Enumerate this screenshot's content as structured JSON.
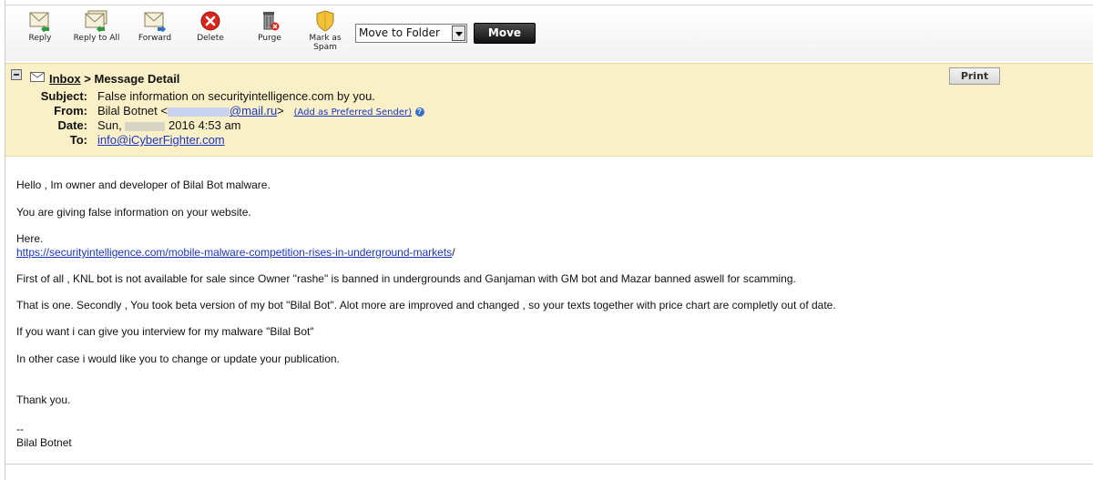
{
  "toolbar": {
    "buttons": [
      {
        "label": "Reply",
        "icon": "reply-icon"
      },
      {
        "label": "Reply to All",
        "icon": "reply-all-icon"
      },
      {
        "label": "Forward",
        "icon": "forward-icon"
      },
      {
        "label": "Delete",
        "icon": "delete-icon"
      },
      {
        "label": "Purge",
        "icon": "purge-icon"
      },
      {
        "label": "Mark as Spam",
        "label_line1": "Mark as",
        "label_line2": "Spam",
        "icon": "spam-shield-icon"
      }
    ],
    "move_select_value": "Move to Folder",
    "move_label": "Move"
  },
  "header": {
    "breadcrumb_link": "Inbox",
    "breadcrumb_rest": " > Message Detail",
    "print_label": "Print",
    "subject_label": "Subject:",
    "subject_value": "False information on securityintelligence.com by you.",
    "from_label": "From:",
    "from_name": "Bilal Botnet <",
    "from_domain": "@mail.ru",
    "from_close": ">",
    "add_preferred": "(Add as Preferred Sender)",
    "date_label": "Date:",
    "date_prefix": "Sun,",
    "date_suffix": "2016 4:53 am",
    "to_label": "To:",
    "to_value": "info@iCyberFighter.com"
  },
  "message": {
    "greeting": "Hello , Im owner and developer of Bilal Bot malware.",
    "line2": "You are giving false information on your website.",
    "here": "Here.",
    "url": "https://securityintelligence.com/mobile-malware-competition-rises-in-underground-markets",
    "url_suffix": "/",
    "para_first": "First of all , KNL bot is not available for sale since Owner \"rashe\" is banned in undergrounds and Ganjaman with GM bot and Mazar banned aswell for scamming.",
    "para_second": "That is one. Secondly , You took beta version of my bot \"Bilal Bot\". Alot more are improved and changed , so your texts together with price chart are completly out of date.",
    "para_interview": "If you want i can give you interview for my malware \"Bilal Bot\"",
    "para_update": "In other case i would like you to change or update your publication.",
    "thanks": "Thank you.",
    "sig_dash": "--",
    "sig_name": "Bilal Botnet"
  },
  "colors": {
    "header_bg": "#f9f0c7",
    "link": "#1a35c9",
    "move_button": "#111111"
  }
}
